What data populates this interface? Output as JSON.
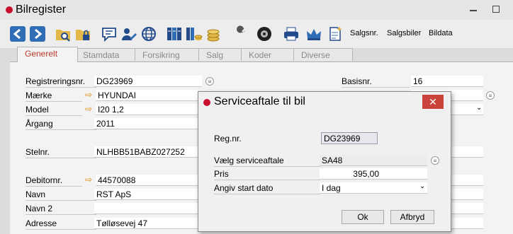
{
  "window": {
    "title": "Bilregister",
    "accent": "#c8102e"
  },
  "toolbar": {
    "icons": [
      "back-arrow-icon",
      "forward-arrow-icon",
      "folder-search-icon",
      "folder-lock-icon",
      "comment-icon",
      "user-edit-icon",
      "globe-icon",
      "binders-icon",
      "binders-coins-icon",
      "coins-icon",
      "wrench-icon",
      "tire-icon",
      "printer-icon",
      "crown-icon",
      "new-document-icon"
    ],
    "salgsnr": "Salgsnr.",
    "salgsbiler": "Salgsbiler",
    "bildata": "Bildata"
  },
  "tabs": [
    {
      "label": "Generelt",
      "active": true
    },
    {
      "label": "Stamdata",
      "active": false
    },
    {
      "label": "Forsikring",
      "active": false
    },
    {
      "label": "Salg",
      "active": false
    },
    {
      "label": "Koder",
      "active": false
    },
    {
      "label": "Diverse",
      "active": false
    }
  ],
  "form": {
    "registreringsnr": {
      "label": "Registreringsnr.",
      "value": "DG23969"
    },
    "maerke": {
      "label": "Mærke",
      "value": "HYUNDAI"
    },
    "model": {
      "label": "Model",
      "value": "I20 1,2"
    },
    "aargang": {
      "label": "Årgang",
      "value": "2011"
    },
    "stelnr": {
      "label": "Stelnr.",
      "value": "NLHBB51BABZ027252"
    },
    "debitornr": {
      "label": "Debitornr.",
      "value": "44570088"
    },
    "navn": {
      "label": "Navn",
      "value": "RST ApS"
    },
    "navn2": {
      "label": "Navn 2",
      "value": ""
    },
    "adresse": {
      "label": "Adresse",
      "value": "Tølløsevej 47"
    },
    "basisnr": {
      "label": "Basisnr.",
      "value": "16"
    }
  },
  "dialog": {
    "title": "Serviceaftale til bil",
    "close_label": "✕",
    "regnr": {
      "label": "Reg.nr.",
      "value": "DG23969"
    },
    "serviceaftale": {
      "label": "Vælg serviceaftale",
      "value": "SA48"
    },
    "pris": {
      "label": "Pris",
      "value": "395,00"
    },
    "startdato": {
      "label": "Angiv start dato",
      "value": "I dag"
    },
    "ok_label": "Ok",
    "cancel_label": "Afbryd"
  }
}
